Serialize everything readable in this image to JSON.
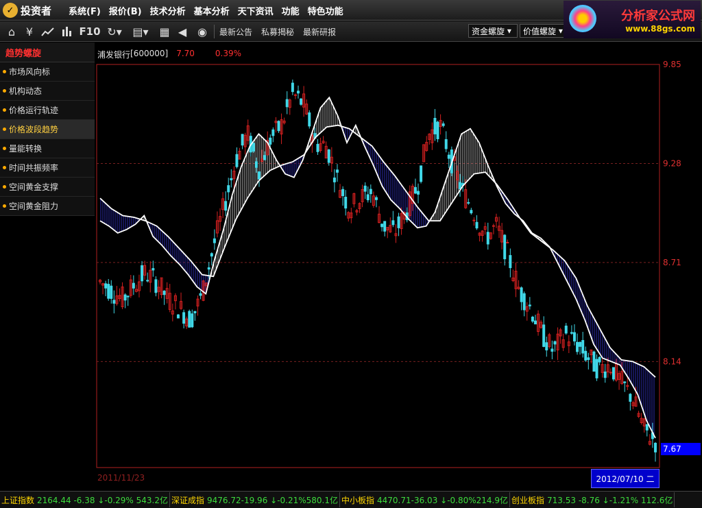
{
  "app": {
    "logo_text": "投资者"
  },
  "menus": [
    "系统(F)",
    "报价(B)",
    "技术分析",
    "基本分析",
    "天下资讯",
    "功能",
    "特色功能"
  ],
  "ad": {
    "name": "分析家公式网",
    "url": "www.88gs.com"
  },
  "toolbar": {
    "f10": "F10",
    "links": [
      "最新公告",
      "私募揭秘",
      "最新研报"
    ],
    "dropdowns": [
      "资金螺旋",
      "价值螺旋"
    ]
  },
  "sidebar": {
    "title": "趋势螺旋",
    "items": [
      "市场风向标",
      "机构动态",
      "价格运行轨迹",
      "价格波段趋势",
      "量能转换",
      "时间共振频率",
      "空间黄金支撑",
      "空间黄金阻力"
    ],
    "active_index": 3
  },
  "stock": {
    "name": "浦发银行",
    "code": "[600000]",
    "price": "7.70",
    "change": "0.39%"
  },
  "chart_data": {
    "type": "line",
    "y_tick_labels": [
      "9.85",
      "9.28",
      "8.71",
      "8.14"
    ],
    "y_ticks": [
      9.85,
      9.28,
      8.71,
      8.14
    ],
    "ylim": [
      7.53,
      9.85
    ],
    "grid": "dashed horizontal at 9.28, 8.71, 8.14",
    "current_price_label": "7.67",
    "x_start": "2011/11/23",
    "x_end": "2012/07/10 二",
    "series": [
      {
        "values": [
          8.95,
          8.92,
          8.88,
          8.9,
          8.93,
          8.98,
          8.86,
          8.81,
          8.75,
          8.7,
          8.64,
          8.57,
          8.53,
          8.73,
          8.9,
          9.1,
          9.26,
          9.38,
          9.45,
          9.4,
          9.3,
          9.22,
          9.2,
          9.3,
          9.45,
          9.6,
          9.66,
          9.55,
          9.4,
          9.5,
          9.38,
          9.27,
          9.15,
          9.07,
          9.02,
          8.96,
          8.91,
          8.92,
          9.0,
          9.15,
          9.3,
          9.45,
          9.48,
          9.4,
          9.27,
          9.15,
          9.05,
          8.99,
          8.95,
          8.88,
          8.85,
          8.8,
          8.7,
          8.6,
          8.5,
          8.38,
          8.24,
          8.16,
          8.14,
          8.12,
          8.04,
          7.95,
          7.8,
          7.7
        ]
      },
      {
        "values": [
          9.08,
          9.02,
          8.98,
          8.97,
          8.95,
          8.92,
          8.86,
          8.79,
          8.72,
          8.64,
          8.63,
          8.8,
          8.96,
          9.08,
          9.18,
          9.24,
          9.27,
          9.29,
          9.33,
          9.43,
          9.49,
          9.5,
          9.48,
          9.43,
          9.38,
          9.29,
          9.21,
          9.12,
          9.03,
          8.95,
          8.95,
          9.05,
          9.15,
          9.22,
          9.23,
          9.16,
          9.07,
          8.97,
          8.88,
          8.83,
          8.78,
          8.72,
          8.62,
          8.46,
          8.34,
          8.22,
          8.15,
          8.14,
          8.11,
          8.05
        ]
      },
      {
        "values": [
          8.6,
          8.55,
          8.5,
          8.58,
          8.65,
          8.6,
          8.5,
          8.45,
          8.38,
          8.52,
          8.8,
          9.05,
          9.3,
          9.45,
          9.25,
          9.42,
          9.5,
          9.68,
          9.62,
          9.4,
          9.38,
          9.18,
          9.02,
          9.08,
          9.12,
          8.92,
          8.88,
          9.0,
          9.15,
          9.45,
          9.5,
          9.3,
          9.12,
          9.0,
          8.85,
          8.92,
          8.75,
          8.55,
          8.45,
          8.3,
          8.2,
          8.3,
          8.25,
          8.17,
          8.1,
          8.12,
          8.02,
          7.93,
          7.75,
          7.68
        ]
      }
    ],
    "candle_colors": {
      "up": "#d42020",
      "down": "#40d8e8"
    }
  },
  "statusbar": [
    {
      "name": "上证指数",
      "value": "2164.44 -6.38 ↓-0.29% 543.2亿"
    },
    {
      "name": "深证成指",
      "value": "9476.72-19.96 ↓-0.21%580.1亿"
    },
    {
      "name": "中小板指",
      "value": "4470.71-36.03 ↓-0.80%214.9亿"
    },
    {
      "name": "创业板指",
      "value": "713.53 -8.76 ↓-1.21% 112.6亿"
    }
  ]
}
